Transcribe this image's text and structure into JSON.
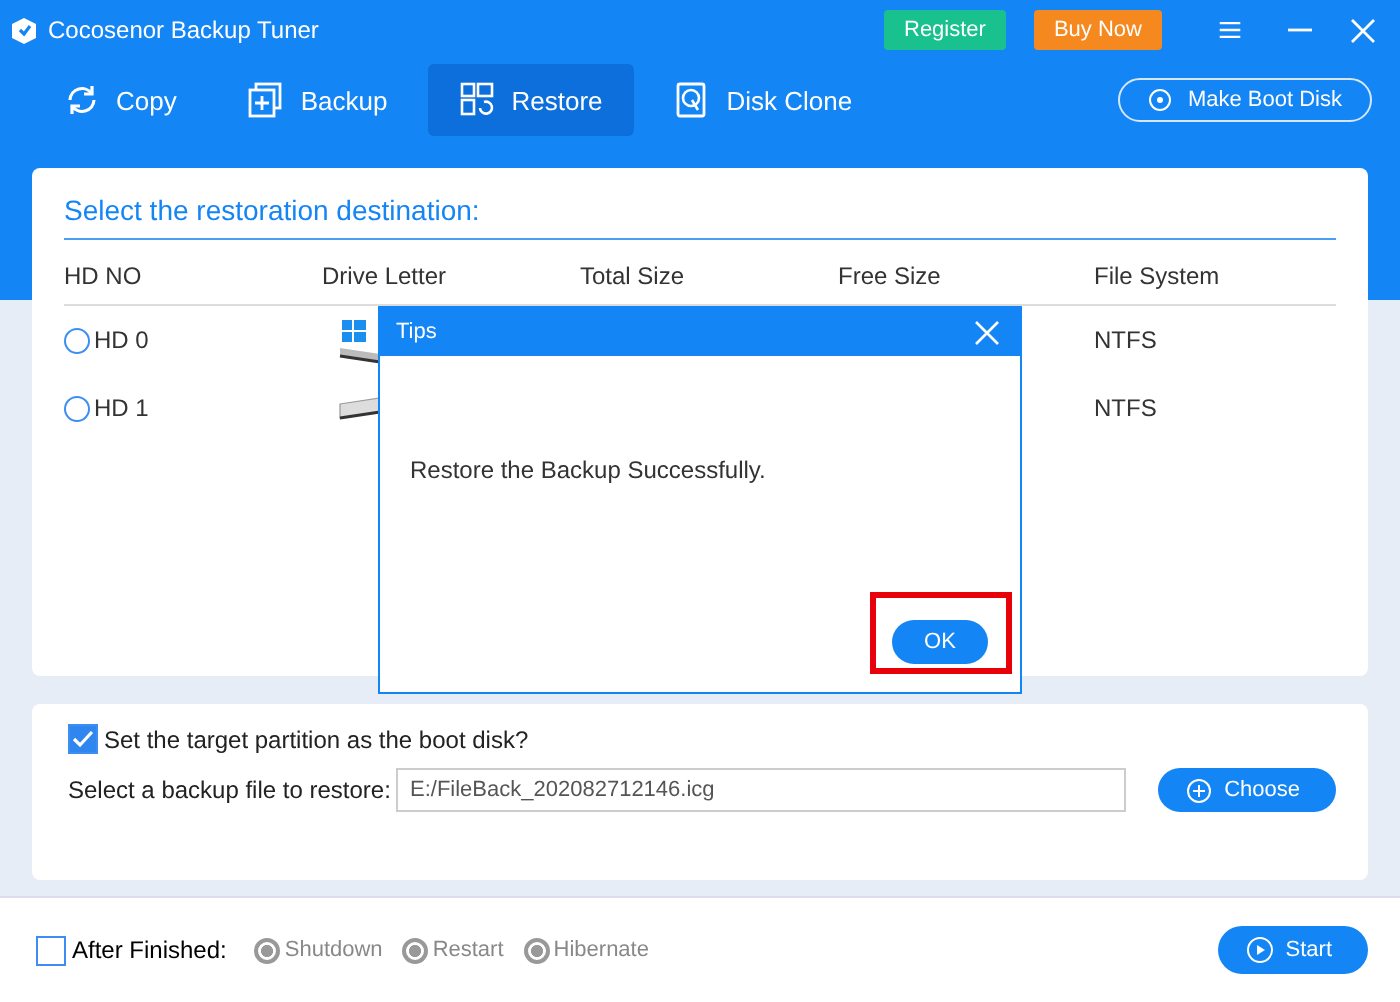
{
  "window": {
    "title": "Cocosenor Backup Tuner"
  },
  "header_buttons": [
    {
      "label": "Register",
      "kind": "register"
    },
    {
      "label": "Buy Now",
      "kind": "buy"
    }
  ],
  "tabs": [
    {
      "label": "Copy",
      "kind": "copy",
      "selected": false
    },
    {
      "label": "Backup",
      "kind": "backup",
      "selected": false
    },
    {
      "label": "Restore",
      "kind": "restore",
      "selected": true
    },
    {
      "label": "Disk Clone",
      "kind": "clone",
      "selected": false
    }
  ],
  "make_boot_disk": {
    "label": "Make Boot Disk"
  },
  "destination": {
    "heading": "Select the restoration destination:",
    "columns": [
      "HD NO",
      "Drive Letter",
      "Total Size",
      "Free Size",
      "File System"
    ],
    "rows": [
      {
        "hd": "HD 0",
        "selected": false,
        "kind": "windows",
        "file_system": "NTFS"
      },
      {
        "hd": "HD 1",
        "selected": false,
        "kind": "plain",
        "file_system": "NTFS"
      }
    ]
  },
  "options": {
    "boot_checkbox": {
      "label": "Set the target partition as the boot disk?",
      "checked": true
    },
    "file_label": "Select a backup file to restore:",
    "file_value": "E:/FileBack_202082712146.icg",
    "choose": "Choose"
  },
  "footer": {
    "after_finished": {
      "label": "After Finished:",
      "checked": false
    },
    "choices": [
      {
        "label": "Shutdown",
        "disabled": true
      },
      {
        "label": "Restart",
        "disabled": true
      },
      {
        "label": "Hibernate",
        "disabled": true
      }
    ],
    "start": "Start"
  },
  "dialog": {
    "title": "Tips",
    "message": "Restore the Backup Successfully.",
    "ok": "OK",
    "ok_highlighted": true
  }
}
